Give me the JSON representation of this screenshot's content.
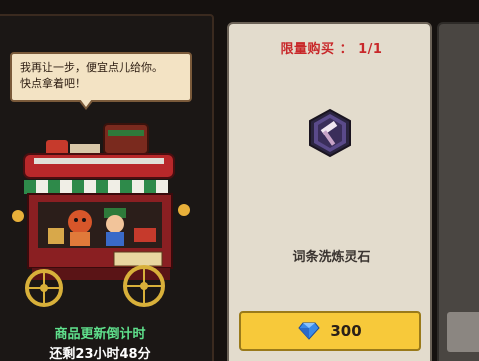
{
  "merchant": {
    "speech": "我再让一步，便宜点儿给你。\n快点拿着吧！",
    "countdown_title": "商品更新倒计时",
    "countdown_value": "还剩23小时48分"
  },
  "product": {
    "limit_label": "限量购买 ： 1/1",
    "item_icon": "gem-hammer-icon",
    "name": "词条洗炼灵石",
    "price": "300",
    "currency_icon": "blue-gem-icon"
  },
  "colors": {
    "limit_text": "#c8282a",
    "countdown_title": "#5fe08c",
    "buy_button": "#f7c93a",
    "card_bg": "#e3dccd"
  }
}
